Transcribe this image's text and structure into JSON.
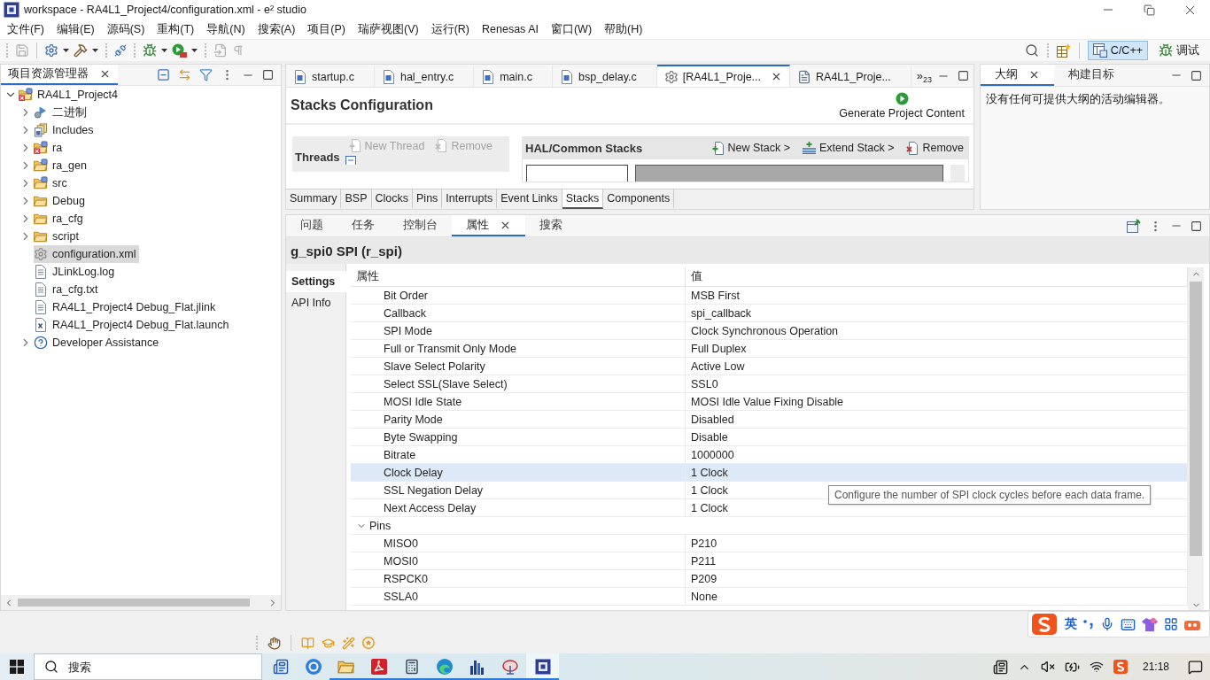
{
  "window": {
    "title": "workspace - RA4L1_Project4/configuration.xml - e² studio"
  },
  "menu": [
    "文件(F)",
    "编辑(E)",
    "源码(S)",
    "重构(T)",
    "导航(N)",
    "搜索(A)",
    "项目(P)",
    "瑞萨视图(V)",
    "运行(R)",
    "Renesas AI",
    "窗口(W)",
    "帮助(H)"
  ],
  "toolbar": {
    "tools": [
      {
        "kind": "save",
        "disabled": true,
        "dropdown": false
      },
      {
        "kind": "launch",
        "disabled": false,
        "dropdown": true
      },
      {
        "kind": "build",
        "disabled": false,
        "dropdown": true
      },
      {
        "kind": "connect",
        "disabled": false,
        "dropdown": false
      },
      {
        "kind": "debug",
        "disabled": false,
        "dropdown": true
      },
      {
        "kind": "run",
        "disabled": false,
        "dropdown": true
      },
      {
        "kind": "open",
        "disabled": true,
        "dropdown": false
      },
      {
        "kind": "whitespace",
        "disabled": true,
        "dropdown": false
      }
    ],
    "perspectives": [
      {
        "label": "C/C++",
        "kind": "cpp",
        "selected": true
      },
      {
        "label": "调试",
        "kind": "debug",
        "selected": false
      }
    ]
  },
  "project_explorer": {
    "tabs": [
      {
        "label": "项目资源管理器",
        "selected": true
      }
    ],
    "tree": [
      {
        "label": "RA4L1_Project4",
        "kind": "project",
        "expanded": true,
        "selected": false,
        "children": [
          {
            "label": "二进制",
            "kind": "binaries",
            "expanded": false,
            "selected": false
          },
          {
            "label": "Includes",
            "kind": "includes",
            "expanded": false,
            "selected": false
          },
          {
            "label": "ra",
            "kind": "source-folder-error",
            "expanded": false,
            "selected": false
          },
          {
            "label": "ra_gen",
            "kind": "source-folder",
            "expanded": false,
            "selected": false
          },
          {
            "label": "src",
            "kind": "source-folder",
            "expanded": false,
            "selected": false
          },
          {
            "label": "Debug",
            "kind": "folder",
            "expanded": false,
            "selected": false
          },
          {
            "label": "ra_cfg",
            "kind": "folder",
            "expanded": false,
            "selected": false
          },
          {
            "label": "script",
            "kind": "folder",
            "expanded": false,
            "selected": false
          },
          {
            "label": "configuration.xml",
            "kind": "config-file",
            "selected": true
          },
          {
            "label": "JLinkLog.log",
            "kind": "text-file",
            "selected": false
          },
          {
            "label": "ra_cfg.txt",
            "kind": "text-file",
            "selected": false
          },
          {
            "label": "RA4L1_Project4 Debug_Flat.jlink",
            "kind": "text-file",
            "selected": false
          },
          {
            "label": "RA4L1_Project4 Debug_Flat.launch",
            "kind": "launch-file",
            "selected": false
          },
          {
            "label": "Developer Assistance",
            "kind": "help",
            "expanded": false,
            "selected": false
          }
        ]
      }
    ]
  },
  "editor": {
    "tabs": [
      {
        "label": "startup.c",
        "kind": "c-file",
        "selected": false
      },
      {
        "label": "hal_entry.c",
        "kind": "c-file",
        "selected": false
      },
      {
        "label": "main.c",
        "kind": "c-file",
        "selected": false
      },
      {
        "label": "bsp_delay.c",
        "kind": "c-file",
        "selected": false
      },
      {
        "label": "[RA4L1_Proje...",
        "kind": "config",
        "selected": true
      },
      {
        "label": "RA4L1_Proje...",
        "kind": "text",
        "selected": false
      }
    ],
    "overflow": {
      "symbol": "»",
      "count": "23"
    },
    "title": "Stacks Configuration",
    "generate_button": "Generate Project Content",
    "threads": {
      "title": "Threads",
      "actions": [
        {
          "label": "New Thread",
          "kind": "new-thread",
          "disabled": true
        },
        {
          "label": "Remove",
          "kind": "remove",
          "disabled": true
        }
      ]
    },
    "stacks": {
      "title": "HAL/Common Stacks",
      "actions": [
        {
          "label": "New Stack >",
          "kind": "new-stack",
          "disabled": false
        },
        {
          "label": "Extend Stack >",
          "kind": "extend-stack",
          "disabled": false
        },
        {
          "label": "Remove",
          "kind": "remove",
          "disabled": false
        }
      ]
    },
    "page_tabs": [
      {
        "label": "Summary",
        "selected": false
      },
      {
        "label": "BSP",
        "selected": false
      },
      {
        "label": "Clocks",
        "selected": false
      },
      {
        "label": "Pins",
        "selected": false
      },
      {
        "label": "Interrupts",
        "selected": false
      },
      {
        "label": "Event Links",
        "selected": false
      },
      {
        "label": "Stacks",
        "selected": true
      },
      {
        "label": "Components",
        "selected": false
      }
    ]
  },
  "outline": {
    "tabs": [
      {
        "label": "大纲",
        "selected": true
      },
      {
        "label": "构建目标",
        "selected": false
      }
    ],
    "message": "没有任何可提供大纲的活动编辑器。"
  },
  "properties_view": {
    "tabs": [
      {
        "label": "问题",
        "selected": false
      },
      {
        "label": "任务",
        "selected": false
      },
      {
        "label": "控制台",
        "selected": false
      },
      {
        "label": "属性",
        "selected": true
      },
      {
        "label": "搜索",
        "selected": false
      }
    ],
    "title": "g_spi0 SPI (r_spi)",
    "side_tabs": [
      {
        "label": "Settings",
        "selected": true
      },
      {
        "label": "API Info",
        "selected": false
      }
    ],
    "columns": [
      "属性",
      "值"
    ],
    "groups": [
      {
        "rows": [
          {
            "property": "Bit Order",
            "value": "MSB First",
            "selected": false
          },
          {
            "property": "Callback",
            "value": "spi_callback",
            "selected": false
          },
          {
            "property": "SPI Mode",
            "value": "Clock Synchronous Operation",
            "selected": false
          },
          {
            "property": "Full or Transmit Only Mode",
            "value": "Full Duplex",
            "selected": false
          },
          {
            "property": "Slave Select Polarity",
            "value": "Active Low",
            "selected": false
          },
          {
            "property": "Select SSL(Slave Select)",
            "value": "SSL0",
            "selected": false
          },
          {
            "property": "MOSI Idle State",
            "value": "MOSI Idle Value Fixing Disable",
            "selected": false
          },
          {
            "property": "Parity Mode",
            "value": "Disabled",
            "selected": false
          },
          {
            "property": "Byte Swapping",
            "value": "Disable",
            "selected": false
          },
          {
            "property": "Bitrate",
            "value": "1000000",
            "selected": false
          },
          {
            "property": "Clock Delay",
            "value": "1 Clock",
            "selected": true
          },
          {
            "property": "SSL Negation Delay",
            "value": "1 Clock",
            "selected": false
          },
          {
            "property": "Next Access Delay",
            "value": "1 Clock",
            "selected": false
          }
        ]
      },
      {
        "name": "Pins",
        "expanded": true,
        "selected": false,
        "rows": [
          {
            "property": "MISO0",
            "value": "P210",
            "selected": false
          },
          {
            "property": "MOSI0",
            "value": "P211",
            "selected": false
          },
          {
            "property": "RSPCK0",
            "value": "P209",
            "selected": false
          },
          {
            "property": "SSLA0",
            "value": "None",
            "selected": false
          }
        ]
      }
    ],
    "tooltip": "Configure the number of SPI clock cycles before each data frame."
  },
  "ime_bar": {
    "mode": "英"
  },
  "taskbar": {
    "search_placeholder": "搜索",
    "apps": [
      {
        "kind": "window",
        "running": false,
        "selected": false
      },
      {
        "kind": "round",
        "running": false,
        "selected": false
      },
      {
        "kind": "folder",
        "running": true,
        "selected": false
      },
      {
        "kind": "pdf",
        "running": true,
        "selected": false
      },
      {
        "kind": "calculator",
        "running": true,
        "selected": false
      },
      {
        "kind": "browser",
        "running": true,
        "selected": false
      },
      {
        "kind": "bars",
        "running": true,
        "selected": false
      },
      {
        "kind": "dish",
        "running": true,
        "selected": false
      },
      {
        "kind": "chip",
        "running": true,
        "selected": true
      }
    ],
    "time": "21:18"
  }
}
